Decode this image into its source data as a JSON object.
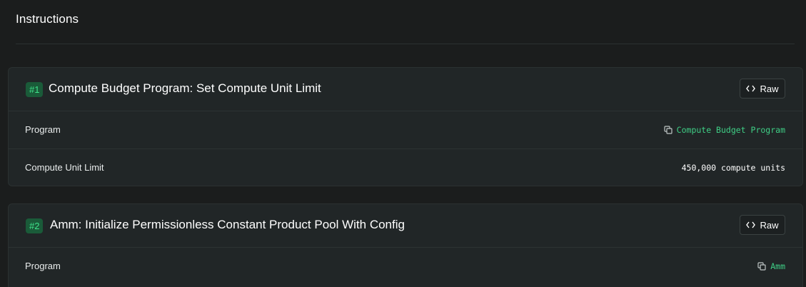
{
  "section": {
    "title": "Instructions"
  },
  "instructions": [
    {
      "index": "#1",
      "title": "Compute Budget Program: Set Compute Unit Limit",
      "raw_label": "Raw",
      "rows": [
        {
          "label": "Program",
          "value": "Compute Budget Program",
          "type": "link",
          "icon": "copy-icon"
        },
        {
          "label": "Compute Unit Limit",
          "value": "450,000 compute units",
          "type": "text"
        }
      ]
    },
    {
      "index": "#2",
      "title": "Amm: Initialize Permissionless Constant Product Pool With Config",
      "raw_label": "Raw",
      "rows": [
        {
          "label": "Program",
          "value": "Amm",
          "type": "link",
          "icon": "copy-icon"
        }
      ]
    }
  ],
  "colors": {
    "background": "#1b1d1d",
    "card": "#212627",
    "badge_bg": "#1a5b39",
    "accent_green": "#3fcf86"
  },
  "icons": {
    "raw": "code-brackets-icon",
    "copy": "copy-icon"
  }
}
